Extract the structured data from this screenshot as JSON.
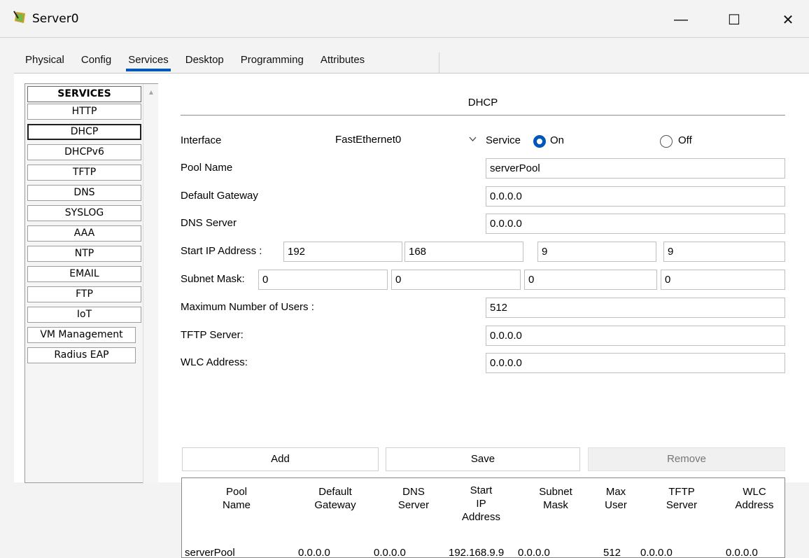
{
  "window": {
    "title": "Server0",
    "icon": "server-app-icon",
    "controls": {
      "minimize": "—",
      "maximize": "☐",
      "close": "✕"
    }
  },
  "tabs": [
    "Physical",
    "Config",
    "Services",
    "Desktop",
    "Programming",
    "Attributes"
  ],
  "active_tab": "Services",
  "sidebar": {
    "heading": "SERVICES",
    "items": [
      "HTTP",
      "DHCP",
      "DHCPv6",
      "TFTP",
      "DNS",
      "SYSLOG",
      "AAA",
      "NTP",
      "EMAIL",
      "FTP",
      "IoT",
      "VM Management",
      "Radius EAP"
    ],
    "active": "DHCP"
  },
  "dhcp": {
    "title": "DHCP",
    "interface_label": "Interface",
    "interface_value": "FastEthernet0",
    "service_label": "Service",
    "on_label": "On",
    "off_label": "Off",
    "service_state": "On",
    "pool_name_label": "Pool Name",
    "pool_name": "serverPool",
    "default_gateway_label": "Default Gateway",
    "default_gateway": "0.0.0.0",
    "dns_server_label": "DNS Server",
    "dns_server": "0.0.0.0",
    "start_ip_label": "Start IP Address :",
    "start_ip": [
      "192",
      "168",
      "9",
      "9"
    ],
    "subnet_mask_label": "Subnet Mask:",
    "subnet_mask": [
      "0",
      "0",
      "0",
      "0"
    ],
    "max_users_label": "Maximum Number of Users :",
    "max_users": "512",
    "tftp_server_label": "TFTP Server:",
    "tftp_server": "0.0.0.0",
    "wlc_address_label": "WLC Address:",
    "wlc_address": "0.0.0.0",
    "buttons": {
      "add": "Add",
      "save": "Save",
      "remove": "Remove"
    },
    "table": {
      "headers": [
        "Pool Name",
        "Default Gateway",
        "DNS Server",
        "Start IP Address",
        "Subnet Mask",
        "Max User",
        "TFTP Server",
        "WLC Address"
      ],
      "rows": [
        [
          "serverPool",
          "0.0.0.0",
          "0.0.0.0",
          "192.168.9.9",
          "0.0.0.0",
          "512",
          "0.0.0.0",
          "0.0.0.0"
        ]
      ]
    }
  },
  "colors": {
    "accent": "#0057b8",
    "window_bg": "#f3f3f3",
    "panel_bg": "#ffffff"
  }
}
